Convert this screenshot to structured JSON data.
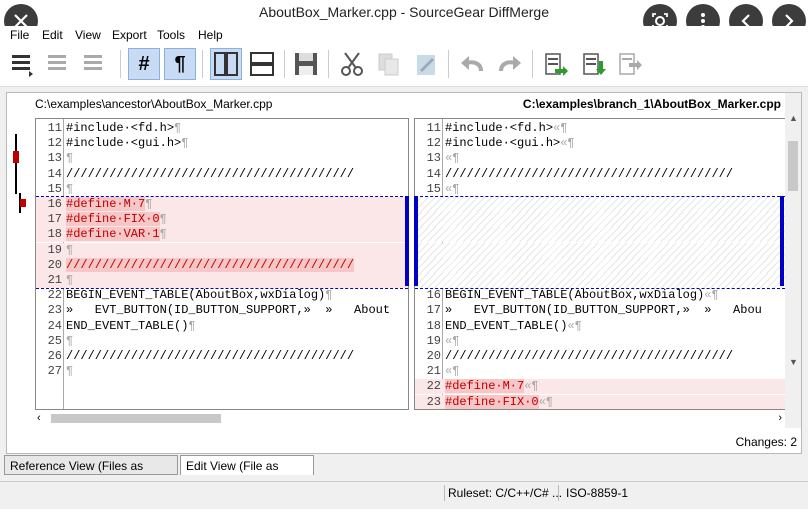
{
  "window": {
    "title": "AboutBox_Marker.cpp - SourceGear DiffMerge"
  },
  "menu": [
    "File",
    "Edit",
    "View",
    "Export",
    "Tools",
    "Help"
  ],
  "paths": {
    "left": "C:\\examples\\ancestor\\AboutBox_Marker.cpp",
    "right": "C:\\examples\\branch_1\\AboutBox_Marker.cpp"
  },
  "left_rows": [
    {
      "ln": "11",
      "code": "#include·<fd.h>",
      "ws": "¶",
      "type": "normal"
    },
    {
      "ln": "12",
      "code": "#include·<gui.h>",
      "ws": "¶",
      "type": "normal"
    },
    {
      "ln": "13",
      "code": "",
      "ws": "¶",
      "type": "normal"
    },
    {
      "ln": "14",
      "code": "////////////////////////////////////////",
      "ws": "",
      "type": "normal"
    },
    {
      "ln": "15",
      "code": "",
      "ws": "¶",
      "type": "normal"
    },
    {
      "ln": "16",
      "code": "#define·M·7",
      "ws": "¶",
      "type": "del"
    },
    {
      "ln": "17",
      "code": "#define·FIX·0",
      "ws": "¶",
      "type": "del"
    },
    {
      "ln": "18",
      "code": "#define·VAR·1",
      "ws": "¶",
      "type": "del"
    },
    {
      "ln": "19",
      "code": "",
      "ws": "¶",
      "type": "del"
    },
    {
      "ln": "20",
      "code": "////////////////////////////////////////",
      "ws": "",
      "type": "del"
    },
    {
      "ln": "21",
      "code": "",
      "ws": "¶",
      "type": "del"
    },
    {
      "ln": "22",
      "code": "BEGIN_EVENT_TABLE(AboutBox,wxDialog)",
      "ws": "¶",
      "type": "normal"
    },
    {
      "ln": "23",
      "code": "»   EVT_BUTTON(ID_BUTTON_SUPPORT,»  »   About",
      "ws": "",
      "type": "normal"
    },
    {
      "ln": "24",
      "code": "END_EVENT_TABLE()",
      "ws": "¶",
      "type": "normal"
    },
    {
      "ln": "25",
      "code": "",
      "ws": "¶",
      "type": "normal"
    },
    {
      "ln": "26",
      "code": "////////////////////////////////////////",
      "ws": "",
      "type": "normal"
    },
    {
      "ln": "27",
      "code": "",
      "ws": "¶",
      "type": "normal"
    }
  ],
  "right_rows": [
    {
      "ln": "11",
      "code": "#include·<fd.h>",
      "ws": "«¶",
      "type": "normal"
    },
    {
      "ln": "12",
      "code": "#include·<gui.h>",
      "ws": "«¶",
      "type": "normal"
    },
    {
      "ln": "13",
      "code": "",
      "ws": "«¶",
      "type": "normal"
    },
    {
      "ln": "14",
      "code": "////////////////////////////////////////",
      "ws": "",
      "type": "normal"
    },
    {
      "ln": "15",
      "code": "",
      "ws": "«¶",
      "type": "normal"
    },
    {
      "ln": "",
      "code": "",
      "ws": "",
      "type": "hatch"
    },
    {
      "ln": "",
      "code": "",
      "ws": "",
      "type": "hatch"
    },
    {
      "ln": "",
      "code": "",
      "ws": "",
      "type": "hatch"
    },
    {
      "ln": "",
      "code": "",
      "ws": "",
      "type": "hatch"
    },
    {
      "ln": "",
      "code": "",
      "ws": "",
      "type": "hatch"
    },
    {
      "ln": "",
      "code": "",
      "ws": "",
      "type": "hatch"
    },
    {
      "ln": "16",
      "code": "BEGIN_EVENT_TABLE(AboutBox,wxDialog)",
      "ws": "«¶",
      "type": "normal"
    },
    {
      "ln": "17",
      "code": "»   EVT_BUTTON(ID_BUTTON_SUPPORT,»  »   Abou",
      "ws": "",
      "type": "normal"
    },
    {
      "ln": "18",
      "code": "END_EVENT_TABLE()",
      "ws": "«¶",
      "type": "normal"
    },
    {
      "ln": "19",
      "code": "",
      "ws": "«¶",
      "type": "normal"
    },
    {
      "ln": "20",
      "code": "////////////////////////////////////////",
      "ws": "",
      "type": "normal"
    },
    {
      "ln": "21",
      "code": "",
      "ws": "«¶",
      "type": "normal"
    },
    {
      "ln": "22",
      "code": "#define·M·7",
      "ws": "«¶",
      "type": "del"
    },
    {
      "ln": "23",
      "code": "#define·FIX·0",
      "ws": "«¶",
      "type": "del"
    }
  ],
  "changes": "Changes: 2",
  "tabs": [
    "Reference View (Files as Loaded)",
    "Edit View (File as Edited)"
  ],
  "status": {
    "ruleset": "Ruleset: C/C++/C# ...",
    "encoding": "ISO-8859-1"
  },
  "colors": {
    "accent": "#0000c8",
    "delete_bg": "#fbe7e7",
    "delete_hl": "#f7c6c6",
    "delete_text": "#c00000"
  }
}
